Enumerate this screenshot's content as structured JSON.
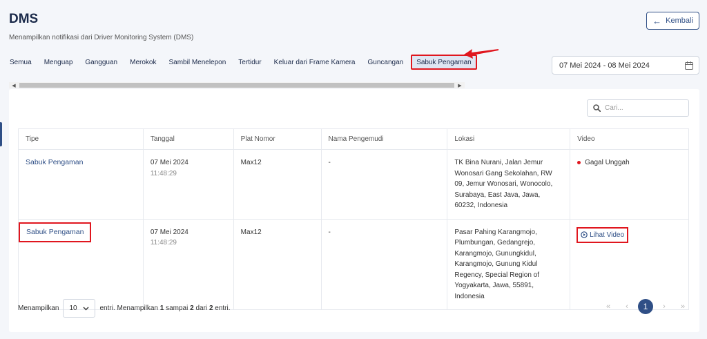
{
  "header": {
    "title": "DMS",
    "subtitle": "Menampilkan notifikasi dari Driver Monitoring System (DMS)",
    "back_label": "Kembali"
  },
  "tabs": [
    {
      "label": "Semua",
      "active": false
    },
    {
      "label": "Menguap",
      "active": false
    },
    {
      "label": "Gangguan",
      "active": false
    },
    {
      "label": "Merokok",
      "active": false
    },
    {
      "label": "Sambil Menelepon",
      "active": false
    },
    {
      "label": "Tertidur",
      "active": false
    },
    {
      "label": "Keluar dari Frame Kamera",
      "active": false
    },
    {
      "label": "Guncangan",
      "active": false
    },
    {
      "label": "Sabuk Pengaman",
      "active": true
    }
  ],
  "date_range": {
    "value": "07 Mei 2024 - 08 Mei 2024"
  },
  "search": {
    "placeholder": "Cari..."
  },
  "table": {
    "columns": [
      "Tipe",
      "Tanggal",
      "Plat Nomor",
      "Nama Pengemudi",
      "Lokasi",
      "Video"
    ],
    "rows": [
      {
        "type": "Sabuk Pengaman",
        "date": "07 Mei 2024",
        "time": "11:48:29",
        "plate": "Max12",
        "driver": "-",
        "location": "TK Bina Nurani, Jalan Jemur Wonosari Gang Sekolahan, RW 09, Jemur Wonosari, Wonocolo, Surabaya, East Java, Jawa, 60232, Indonesia",
        "video": "Gagal Unggah"
      },
      {
        "type": "Sabuk Pengaman",
        "date": "07 Mei 2024",
        "time": "11:48:29",
        "plate": "Max12",
        "driver": "-",
        "location": "Pasar Pahing Karangmojo, Plumbungan, Gedangrejo, Karangmojo, Gunungkidul, Karangmojo, Gunung Kidul Regency, Special Region of Yogyakarta, Jawa, 55891, Indonesia",
        "video": "Lihat Video"
      }
    ]
  },
  "footer": {
    "show_label": "Menampilkan",
    "page_size": "10",
    "entries_prefix": "entri. Menampilkan",
    "from": "1",
    "to_word": "sampai",
    "to": "2",
    "of_word": "dari",
    "total": "2",
    "entries_suffix": "entri."
  },
  "pagination": {
    "first": "«",
    "prev": "‹",
    "current": "1",
    "next": "›",
    "last": "»"
  },
  "colors": {
    "accent": "#2f4f86",
    "highlight": "#e0161e"
  }
}
